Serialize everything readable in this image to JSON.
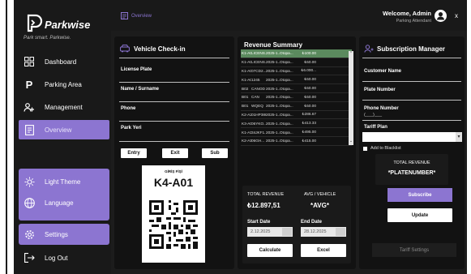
{
  "app": {
    "name": "Parkwise",
    "tagline": "Park smart. Parkwise."
  },
  "header": {
    "breadcrumb": "Overview",
    "welcome": "Welcome, Admin",
    "role": "Parking Attendant",
    "close": "x"
  },
  "sidebar": {
    "items": [
      {
        "label": "Dashboard",
        "icon": "dashboard-grid-icon"
      },
      {
        "label": "Parking Area",
        "icon": "parking-p-icon"
      },
      {
        "label": "Management",
        "icon": "users-icon"
      },
      {
        "label": "Overview",
        "icon": "document-icon"
      },
      {
        "label": "Light Theme",
        "icon": "sun-icon"
      },
      {
        "label": "Language",
        "icon": "globe-icon"
      },
      {
        "label": "Settings",
        "icon": "gear-icon"
      },
      {
        "label": "Log Out",
        "icon": "logout-icon"
      }
    ]
  },
  "checkin": {
    "title": "Vehicle Check-in",
    "fields": [
      "License Plate",
      "Name / Surname",
      "Phone",
      "Park Yeri"
    ],
    "buttons": {
      "entry": "Entry",
      "exit": "Exit",
      "sub": "Sub"
    },
    "ticket": {
      "header": "GİRİŞ FİŞİ",
      "plate": "K4-A01"
    }
  },
  "revenue": {
    "title": "Revenue Summary",
    "rows": [
      [
        "K1-A02",
        "LICENS...",
        "2025-1...",
        "Otopa...",
        "₺100.00"
      ],
      [
        "K1-A02",
        "LICENS...",
        "2025-1...",
        "Otopa...",
        "₺50.00"
      ],
      [
        "K1-A02",
        "07CD2...",
        "2025-1...",
        "Otopa...",
        "₺6.000..."
      ],
      [
        "K1-A03",
        "1245",
        "2025-1...",
        "Otopa...",
        "₺50.00"
      ],
      [
        "B02",
        "CANOD",
        "2025-1...",
        "Otopa...",
        "₺50.00"
      ],
      [
        "B01",
        "CAN",
        "2025-1...",
        "Otopa...",
        "₺50.00"
      ],
      [
        "B01",
        "WQEQ",
        "2025-1...",
        "Otopa...",
        "₺50.00"
      ],
      [
        "K2-A20",
        "01HP386",
        "2025-1...",
        "Otopa...",
        "₺286.67"
      ],
      [
        "K3-A09",
        "06YKO...",
        "2025-1...",
        "Otopa...",
        "₺413.33"
      ],
      [
        "K1-A11",
        "34JKF1...",
        "2025-1...",
        "Otopa...",
        "₺495.00"
      ],
      [
        "K2-A12",
        "06GH...",
        "2025-1...",
        "Otopa...",
        "₺415.00"
      ]
    ],
    "total_label": "TOTAL REVENUE",
    "total_value": "₺12.897,51",
    "avg_label": "AVG / VEHICLE",
    "avg_value": "*AVG*",
    "start_label": "Start Date",
    "start_value": "2.12.2025",
    "end_label": "End Date",
    "end_value": "28.12.2025",
    "calculate": "Calculate",
    "excel": "Excel"
  },
  "subscription": {
    "title": "Subscription Manager",
    "fields": [
      "Customer Name",
      "Plate Number",
      "Phone Number"
    ],
    "phone_placeholder": "(___)___",
    "tariff_label": "Tariff Plan",
    "blacklist": "Add to Blacklist",
    "total_label": "TOTAL REVENUE",
    "plate_placeholder": "*PLATENUMBER*",
    "subscribe": "Subscribe",
    "update": "Update",
    "tariff_settings": "Tariff Settings"
  },
  "colors": {
    "accent": "#8c75d1",
    "selected_row": "#5b8a5e",
    "panel": "#121212",
    "background": "#1c1c1c"
  }
}
